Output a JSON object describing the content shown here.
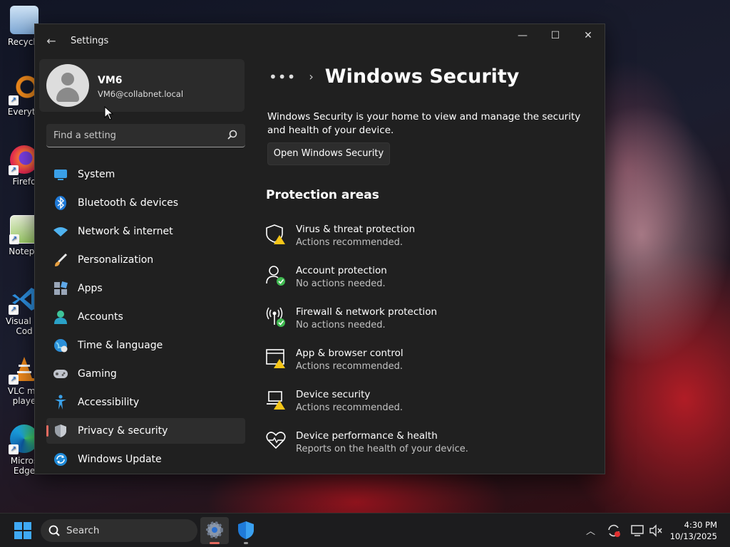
{
  "desktop": {
    "icons": [
      {
        "label": "Recycle",
        "icon": "recycle-bin-icon"
      },
      {
        "label": "Everyth",
        "icon": "everything-search-icon"
      },
      {
        "label": "Firefo",
        "icon": "firefox-icon"
      },
      {
        "label": "Notepa",
        "icon": "notepad-icon"
      },
      {
        "label": "Visual St",
        "label2": "Cod",
        "icon": "vscode-icon"
      },
      {
        "label": "VLC me",
        "label2": "playe",
        "icon": "vlc-icon"
      },
      {
        "label": "Micros",
        "label2": "Edge",
        "icon": "edge-icon"
      }
    ]
  },
  "window": {
    "title": "Settings",
    "back_icon": "back-arrow-icon"
  },
  "profile": {
    "name": "VM6",
    "email": "VM6@collabnet.local"
  },
  "search": {
    "placeholder": "Find a setting"
  },
  "nav": {
    "items": [
      {
        "label": "System",
        "icon": "system-icon"
      },
      {
        "label": "Bluetooth & devices",
        "icon": "bluetooth-icon"
      },
      {
        "label": "Network & internet",
        "icon": "wifi-icon"
      },
      {
        "label": "Personalization",
        "icon": "brush-icon"
      },
      {
        "label": "Apps",
        "icon": "apps-icon"
      },
      {
        "label": "Accounts",
        "icon": "accounts-icon"
      },
      {
        "label": "Time & language",
        "icon": "globe-clock-icon"
      },
      {
        "label": "Gaming",
        "icon": "gamepad-icon"
      },
      {
        "label": "Accessibility",
        "icon": "accessibility-icon"
      },
      {
        "label": "Privacy & security",
        "icon": "shield-icon",
        "active": true
      },
      {
        "label": "Windows Update",
        "icon": "update-icon"
      }
    ]
  },
  "content": {
    "breadcrumb_more": "•••",
    "breadcrumb_sep": "›",
    "title": "Windows Security",
    "description": "Windows Security is your home to view and manage the security and health of your device.",
    "open_button": "Open Windows Security",
    "section_title": "Protection areas",
    "areas": [
      {
        "title": "Virus & threat protection",
        "status": "Actions recommended.",
        "icon": "virus-shield-warning-icon"
      },
      {
        "title": "Account protection",
        "status": "No actions needed.",
        "icon": "account-check-icon"
      },
      {
        "title": "Firewall & network protection",
        "status": "No actions needed.",
        "icon": "firewall-check-icon"
      },
      {
        "title": "App & browser control",
        "status": "Actions recommended.",
        "icon": "browser-warning-icon"
      },
      {
        "title": "Device security",
        "status": "Actions recommended.",
        "icon": "laptop-warning-icon"
      },
      {
        "title": "Device performance & health",
        "status": "Reports on the health of your device.",
        "icon": "heart-icon"
      }
    ]
  },
  "taskbar": {
    "search_label": "Search",
    "time": "4:30 PM",
    "date": "10/13/2025"
  },
  "colors": {
    "accent": "#e36a5f",
    "warning": "#f5c518",
    "ok": "#3fb950",
    "window_bg": "#202020"
  }
}
